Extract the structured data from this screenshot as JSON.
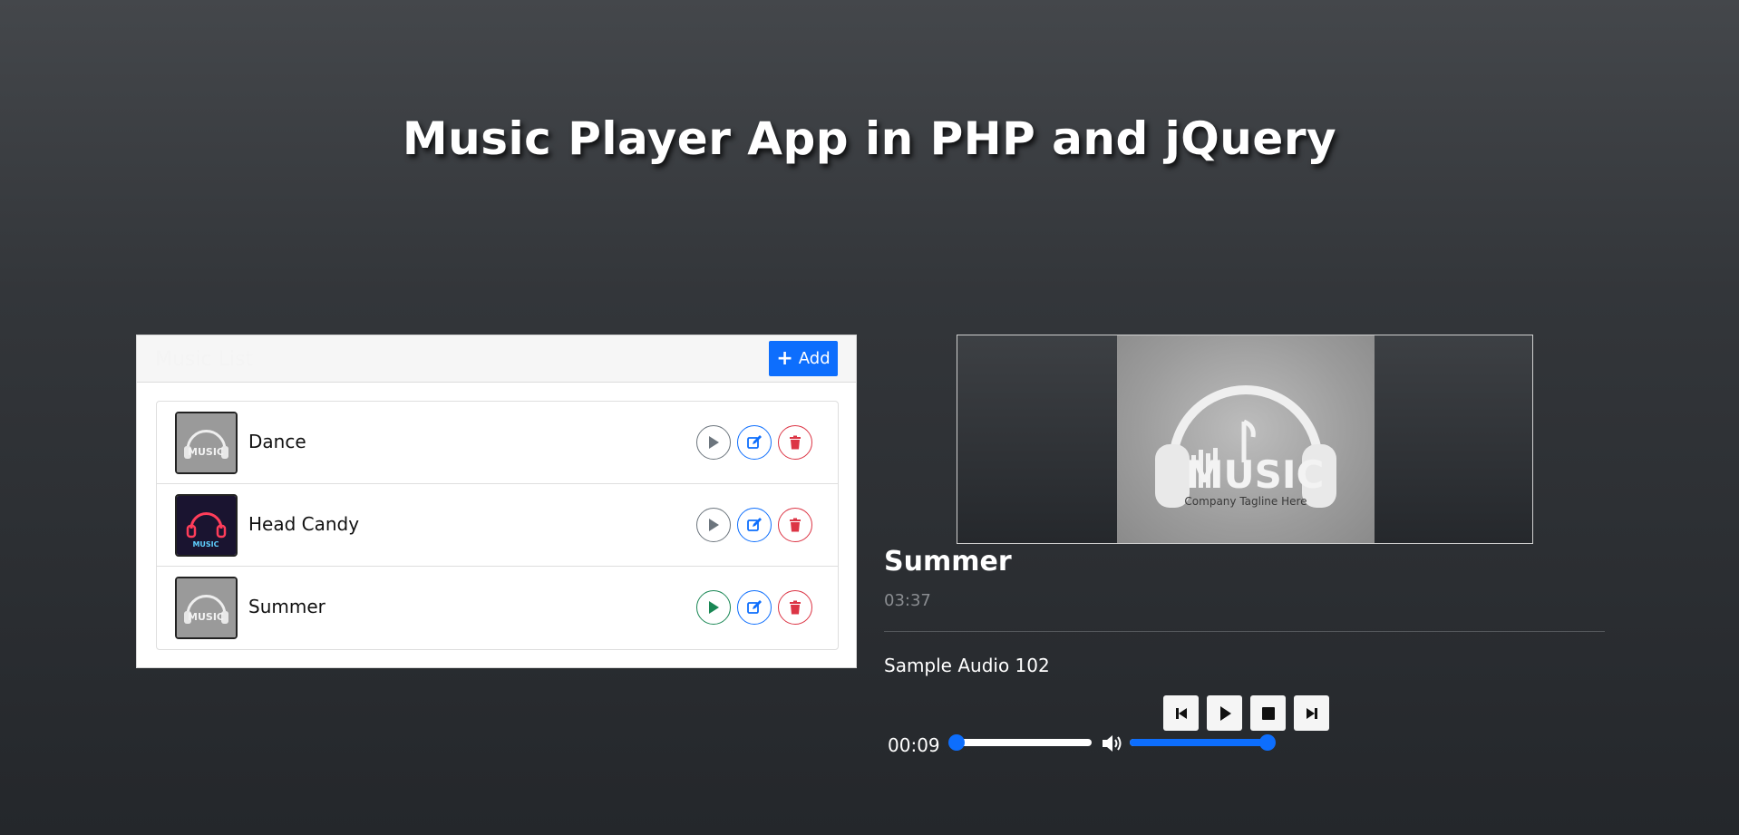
{
  "page": {
    "title": "Music Player App in PHP and jQuery"
  },
  "music_list": {
    "header_title": "Music List",
    "add_button_label": "Add",
    "items": [
      {
        "name": "Dance",
        "thumbnail": "music-logo-gray",
        "play_state": "idle"
      },
      {
        "name": "Head Candy",
        "thumbnail": "neon-headphones",
        "play_state": "idle"
      },
      {
        "name": "Summer",
        "thumbnail": "music-logo-gray",
        "play_state": "active"
      }
    ],
    "icons": {
      "play": "play-icon",
      "edit": "edit-icon",
      "delete": "trash-icon"
    }
  },
  "player": {
    "artwork": "music-logo-headphones",
    "artwork_text": "Company Tagline Here",
    "title": "Summer",
    "duration": "03:37",
    "description": "Sample Audio 102",
    "current_time": "00:09",
    "seek_fraction": 0.04,
    "volume_fraction": 1.0,
    "controls": [
      "previous-icon",
      "play-icon",
      "stop-icon",
      "next-icon"
    ]
  },
  "colors": {
    "accent": "#0d6efd",
    "play_active": "#198754",
    "play_idle": "#6c757d",
    "delete": "#dc3545"
  }
}
